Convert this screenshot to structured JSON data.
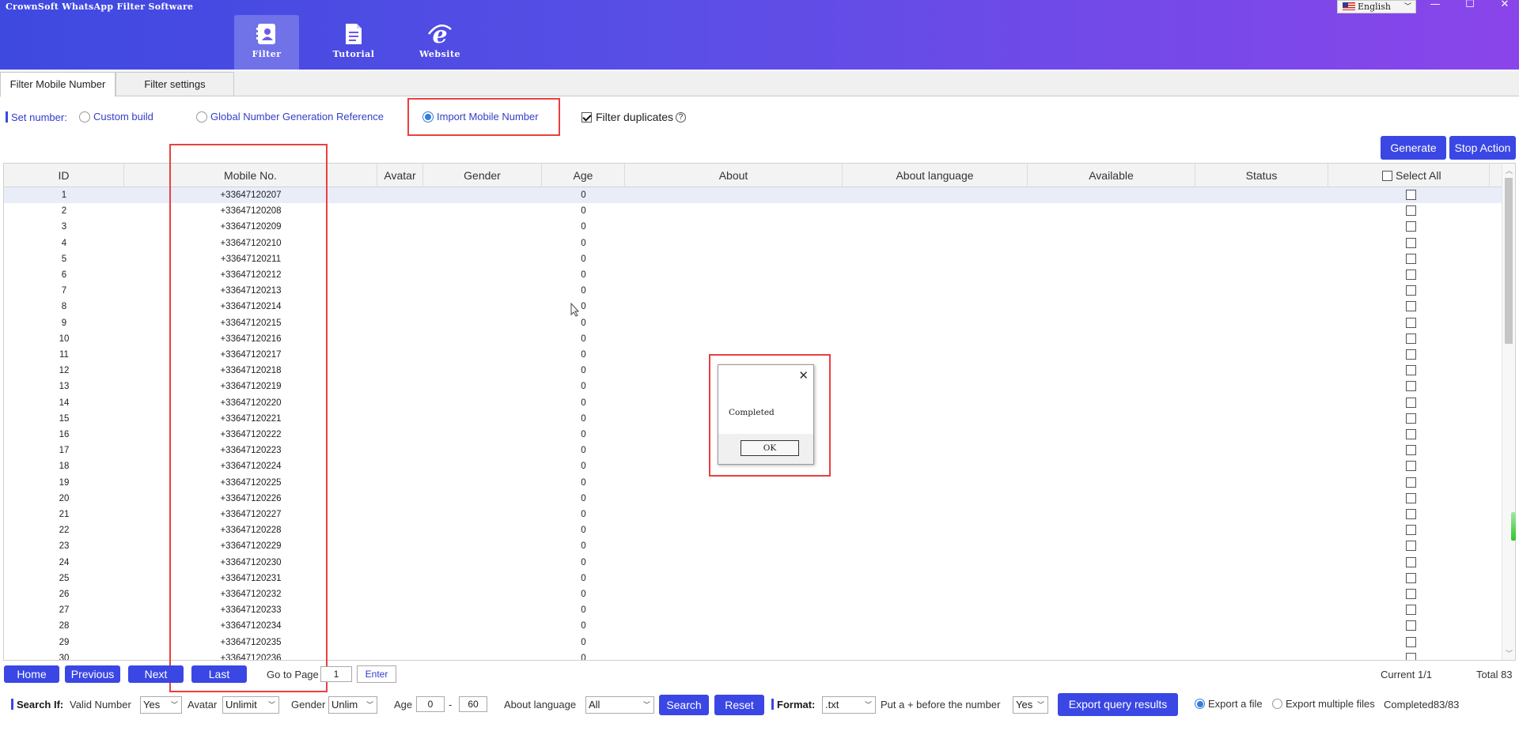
{
  "app": {
    "title": "CrownSoft WhatsApp Filter Software"
  },
  "nav": [
    {
      "label": "Filter",
      "icon": "contact-card-icon",
      "active": true
    },
    {
      "label": "Tutorial",
      "icon": "document-icon",
      "active": false
    },
    {
      "label": "Website",
      "icon": "internet-explorer-icon",
      "active": false
    }
  ],
  "language": {
    "value": "English",
    "icon": "us-flag-icon"
  },
  "window_controls": {
    "minimize": "—",
    "maximize": "☐",
    "close": "✕"
  },
  "tabs": [
    {
      "label": "Filter Mobile Number",
      "active": true
    },
    {
      "label": "Filter settings",
      "active": false
    }
  ],
  "set_number": {
    "label": "Set number:",
    "options": [
      {
        "label": "Custom build",
        "checked": false
      },
      {
        "label": "Global Number Generation Reference",
        "checked": false
      },
      {
        "label": "Import Mobile Number",
        "checked": true
      }
    ],
    "filter_duplicates": {
      "label": "Filter duplicates",
      "checked": true
    }
  },
  "actions": {
    "generate": "Generate",
    "stop": "Stop Action"
  },
  "table": {
    "columns": [
      "ID",
      "Mobile No.",
      "Avatar",
      "Gender",
      "Age",
      "About",
      "About language",
      "Available",
      "Status"
    ],
    "select_all": "Select All",
    "rows": [
      {
        "id": "1",
        "mobile": "+33647120207",
        "age": "0"
      },
      {
        "id": "2",
        "mobile": "+33647120208",
        "age": "0"
      },
      {
        "id": "3",
        "mobile": "+33647120209",
        "age": "0"
      },
      {
        "id": "4",
        "mobile": "+33647120210",
        "age": "0"
      },
      {
        "id": "5",
        "mobile": "+33647120211",
        "age": "0"
      },
      {
        "id": "6",
        "mobile": "+33647120212",
        "age": "0"
      },
      {
        "id": "7",
        "mobile": "+33647120213",
        "age": "0"
      },
      {
        "id": "8",
        "mobile": "+33647120214",
        "age": "0"
      },
      {
        "id": "9",
        "mobile": "+33647120215",
        "age": "0"
      },
      {
        "id": "10",
        "mobile": "+33647120216",
        "age": "0"
      },
      {
        "id": "11",
        "mobile": "+33647120217",
        "age": "0"
      },
      {
        "id": "12",
        "mobile": "+33647120218",
        "age": "0"
      },
      {
        "id": "13",
        "mobile": "+33647120219",
        "age": "0"
      },
      {
        "id": "14",
        "mobile": "+33647120220",
        "age": "0"
      },
      {
        "id": "15",
        "mobile": "+33647120221",
        "age": "0"
      },
      {
        "id": "16",
        "mobile": "+33647120222",
        "age": "0"
      },
      {
        "id": "17",
        "mobile": "+33647120223",
        "age": "0"
      },
      {
        "id": "18",
        "mobile": "+33647120224",
        "age": "0"
      },
      {
        "id": "19",
        "mobile": "+33647120225",
        "age": "0"
      },
      {
        "id": "20",
        "mobile": "+33647120226",
        "age": "0"
      },
      {
        "id": "21",
        "mobile": "+33647120227",
        "age": "0"
      },
      {
        "id": "22",
        "mobile": "+33647120228",
        "age": "0"
      },
      {
        "id": "23",
        "mobile": "+33647120229",
        "age": "0"
      },
      {
        "id": "24",
        "mobile": "+33647120230",
        "age": "0"
      },
      {
        "id": "25",
        "mobile": "+33647120231",
        "age": "0"
      },
      {
        "id": "26",
        "mobile": "+33647120232",
        "age": "0"
      },
      {
        "id": "27",
        "mobile": "+33647120233",
        "age": "0"
      },
      {
        "id": "28",
        "mobile": "+33647120234",
        "age": "0"
      },
      {
        "id": "29",
        "mobile": "+33647120235",
        "age": "0"
      },
      {
        "id": "30",
        "mobile": "+33647120236",
        "age": "0"
      }
    ]
  },
  "pagination": {
    "home": "Home",
    "previous": "Previous",
    "next": "Next",
    "last": "Last",
    "goto_label": "Go to Page",
    "page_value": "1",
    "enter": "Enter",
    "current": "Current 1/1",
    "total": "Total 83"
  },
  "search": {
    "label": "Search If:",
    "valid_number_label": "Valid Number",
    "valid_number_value": "Yes",
    "avatar_label": "Avatar",
    "avatar_value": "Unlimit",
    "gender_label": "Gender",
    "gender_value": "Unlim",
    "age_label": "Age",
    "age_min": "0",
    "age_sep": "-",
    "age_max": "60",
    "about_language_label": "About language",
    "about_language_value": "All",
    "search_btn": "Search",
    "reset_btn": "Reset"
  },
  "format": {
    "label": "Format:",
    "value": ".txt",
    "plus_label": "Put a + before the number",
    "plus_value": "Yes",
    "export_btn": "Export query results",
    "export_file": "Export a file",
    "export_multiple": "Export multiple files",
    "status": "Completed83/83"
  },
  "dialog": {
    "message": "Completed",
    "ok": "OK",
    "close": "✕"
  },
  "colors": {
    "accent": "#3a47e4",
    "header_start": "#3e49e0",
    "header_end": "#8a45ea",
    "highlight": "#e94040"
  }
}
